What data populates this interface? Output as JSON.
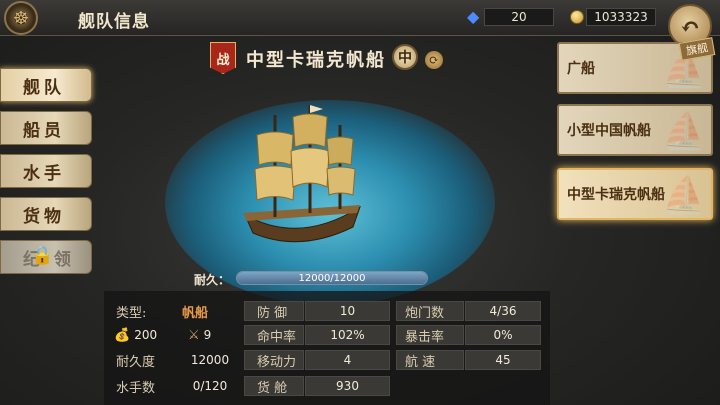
{
  "header": {
    "title": "舰队信息",
    "gems": "20",
    "gold": "1033323"
  },
  "nav": {
    "items": [
      {
        "label": "舰队"
      },
      {
        "label": "船员"
      },
      {
        "label": "水手"
      },
      {
        "label": "货物"
      },
      {
        "label": "纪 领"
      }
    ]
  },
  "ship": {
    "class_badge": "战",
    "name": "中型卡瑞克帆船",
    "size_badge": "中",
    "durability_label": "耐久：",
    "durability_text": "12000/12000",
    "durability_fraction": 1.0
  },
  "stats": {
    "type_label": "类型:",
    "type_value": "帆船",
    "gold_value": "200",
    "cross_value": "9",
    "durability_label": "耐久度",
    "durability_value": "12000",
    "sailors_label": "水手数",
    "sailors_value": "0/120",
    "defense_label": "防 御",
    "defense_value": "10",
    "hit_label": "命中率",
    "hit_value": "102%",
    "move_label": "移动力",
    "move_value": "4",
    "cargo_label": "货 舱",
    "cargo_value": "930",
    "cannon_label": "炮门数",
    "cannon_value": "4/36",
    "crit_label": "暴击率",
    "crit_value": "0%",
    "speed_label": "航 速",
    "speed_value": "45"
  },
  "ship_list": {
    "flag": "旗舰",
    "items": [
      {
        "name": "广船"
      },
      {
        "name": "小型中国帆船"
      },
      {
        "name": "中型卡瑞克帆船"
      }
    ]
  }
}
